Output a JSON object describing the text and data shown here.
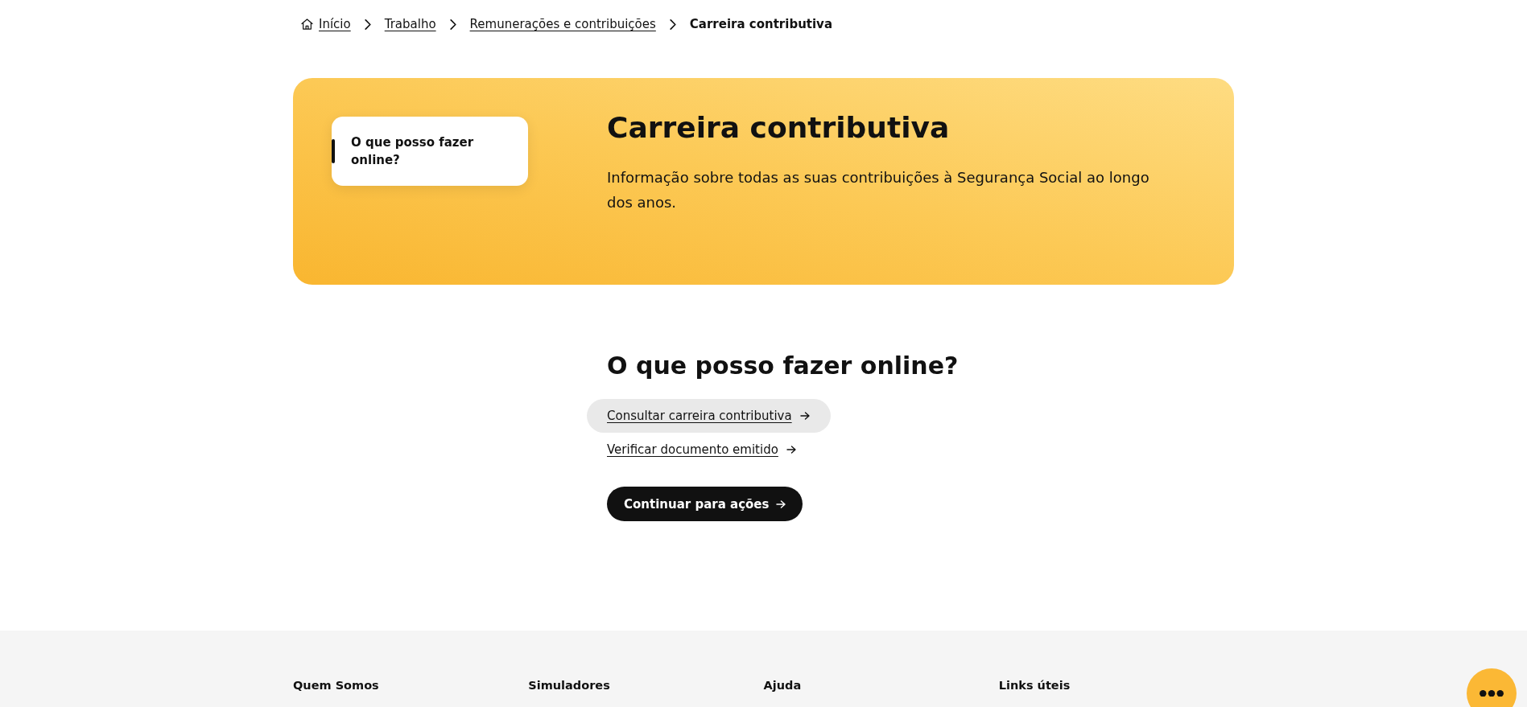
{
  "breadcrumb": [
    {
      "kind": "home",
      "label": "Início"
    },
    {
      "kind": "link",
      "label": "Trabalho"
    },
    {
      "kind": "link",
      "label": "Remunerações e contribuições"
    },
    {
      "kind": "current",
      "label": "Carreira contributiva"
    }
  ],
  "hero": {
    "side_nav": [
      {
        "label": "O que posso fazer online?",
        "selected": true
      }
    ],
    "title": "Carreira contributiva",
    "description": "Informação sobre todas as suas contribuições à Segurança Social ao longo dos anos."
  },
  "section": {
    "heading": "O que posso fazer online?",
    "links": [
      {
        "label": "Consultar carreira contributiva",
        "highlighted": true
      },
      {
        "label": "Verificar documento emitido",
        "highlighted": false
      }
    ],
    "button": "Continuar para ações"
  },
  "footer": {
    "columns": [
      {
        "heading": "Quem Somos"
      },
      {
        "heading": "Simuladores"
      },
      {
        "heading": "Ajuda"
      },
      {
        "heading": "Links úteis"
      }
    ]
  }
}
